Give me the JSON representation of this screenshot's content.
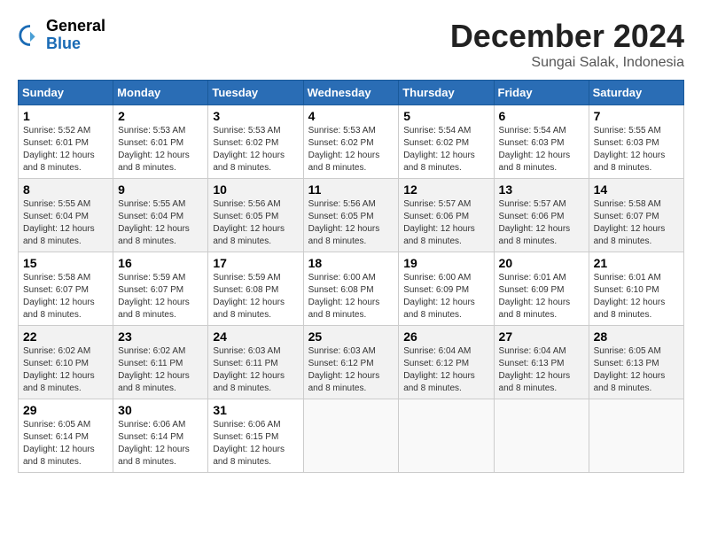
{
  "logo": {
    "general": "General",
    "blue": "Blue"
  },
  "title": "December 2024",
  "location": "Sungai Salak, Indonesia",
  "days_of_week": [
    "Sunday",
    "Monday",
    "Tuesday",
    "Wednesday",
    "Thursday",
    "Friday",
    "Saturday"
  ],
  "weeks": [
    [
      {
        "day": "1",
        "sunrise": "5:52 AM",
        "sunset": "6:01 PM",
        "daylight": "12 hours and 8 minutes."
      },
      {
        "day": "2",
        "sunrise": "5:53 AM",
        "sunset": "6:01 PM",
        "daylight": "12 hours and 8 minutes."
      },
      {
        "day": "3",
        "sunrise": "5:53 AM",
        "sunset": "6:02 PM",
        "daylight": "12 hours and 8 minutes."
      },
      {
        "day": "4",
        "sunrise": "5:53 AM",
        "sunset": "6:02 PM",
        "daylight": "12 hours and 8 minutes."
      },
      {
        "day": "5",
        "sunrise": "5:54 AM",
        "sunset": "6:02 PM",
        "daylight": "12 hours and 8 minutes."
      },
      {
        "day": "6",
        "sunrise": "5:54 AM",
        "sunset": "6:03 PM",
        "daylight": "12 hours and 8 minutes."
      },
      {
        "day": "7",
        "sunrise": "5:55 AM",
        "sunset": "6:03 PM",
        "daylight": "12 hours and 8 minutes."
      }
    ],
    [
      {
        "day": "8",
        "sunrise": "5:55 AM",
        "sunset": "6:04 PM",
        "daylight": "12 hours and 8 minutes."
      },
      {
        "day": "9",
        "sunrise": "5:55 AM",
        "sunset": "6:04 PM",
        "daylight": "12 hours and 8 minutes."
      },
      {
        "day": "10",
        "sunrise": "5:56 AM",
        "sunset": "6:05 PM",
        "daylight": "12 hours and 8 minutes."
      },
      {
        "day": "11",
        "sunrise": "5:56 AM",
        "sunset": "6:05 PM",
        "daylight": "12 hours and 8 minutes."
      },
      {
        "day": "12",
        "sunrise": "5:57 AM",
        "sunset": "6:06 PM",
        "daylight": "12 hours and 8 minutes."
      },
      {
        "day": "13",
        "sunrise": "5:57 AM",
        "sunset": "6:06 PM",
        "daylight": "12 hours and 8 minutes."
      },
      {
        "day": "14",
        "sunrise": "5:58 AM",
        "sunset": "6:07 PM",
        "daylight": "12 hours and 8 minutes."
      }
    ],
    [
      {
        "day": "15",
        "sunrise": "5:58 AM",
        "sunset": "6:07 PM",
        "daylight": "12 hours and 8 minutes."
      },
      {
        "day": "16",
        "sunrise": "5:59 AM",
        "sunset": "6:07 PM",
        "daylight": "12 hours and 8 minutes."
      },
      {
        "day": "17",
        "sunrise": "5:59 AM",
        "sunset": "6:08 PM",
        "daylight": "12 hours and 8 minutes."
      },
      {
        "day": "18",
        "sunrise": "6:00 AM",
        "sunset": "6:08 PM",
        "daylight": "12 hours and 8 minutes."
      },
      {
        "day": "19",
        "sunrise": "6:00 AM",
        "sunset": "6:09 PM",
        "daylight": "12 hours and 8 minutes."
      },
      {
        "day": "20",
        "sunrise": "6:01 AM",
        "sunset": "6:09 PM",
        "daylight": "12 hours and 8 minutes."
      },
      {
        "day": "21",
        "sunrise": "6:01 AM",
        "sunset": "6:10 PM",
        "daylight": "12 hours and 8 minutes."
      }
    ],
    [
      {
        "day": "22",
        "sunrise": "6:02 AM",
        "sunset": "6:10 PM",
        "daylight": "12 hours and 8 minutes."
      },
      {
        "day": "23",
        "sunrise": "6:02 AM",
        "sunset": "6:11 PM",
        "daylight": "12 hours and 8 minutes."
      },
      {
        "day": "24",
        "sunrise": "6:03 AM",
        "sunset": "6:11 PM",
        "daylight": "12 hours and 8 minutes."
      },
      {
        "day": "25",
        "sunrise": "6:03 AM",
        "sunset": "6:12 PM",
        "daylight": "12 hours and 8 minutes."
      },
      {
        "day": "26",
        "sunrise": "6:04 AM",
        "sunset": "6:12 PM",
        "daylight": "12 hours and 8 minutes."
      },
      {
        "day": "27",
        "sunrise": "6:04 AM",
        "sunset": "6:13 PM",
        "daylight": "12 hours and 8 minutes."
      },
      {
        "day": "28",
        "sunrise": "6:05 AM",
        "sunset": "6:13 PM",
        "daylight": "12 hours and 8 minutes."
      }
    ],
    [
      {
        "day": "29",
        "sunrise": "6:05 AM",
        "sunset": "6:14 PM",
        "daylight": "12 hours and 8 minutes."
      },
      {
        "day": "30",
        "sunrise": "6:06 AM",
        "sunset": "6:14 PM",
        "daylight": "12 hours and 8 minutes."
      },
      {
        "day": "31",
        "sunrise": "6:06 AM",
        "sunset": "6:15 PM",
        "daylight": "12 hours and 8 minutes."
      },
      null,
      null,
      null,
      null
    ]
  ]
}
